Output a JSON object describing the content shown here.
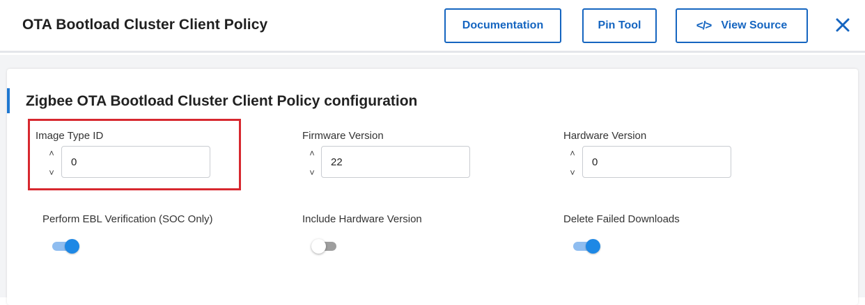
{
  "header": {
    "title": "OTA Bootload Cluster Client Policy",
    "buttons": {
      "documentation": "Documentation",
      "pin_tool": "Pin Tool",
      "view_source": "View Source",
      "view_source_icon": "</>"
    },
    "close_glyph": "×"
  },
  "section": {
    "title": "Zigbee OTA Bootload Cluster Client Policy configuration"
  },
  "fields": [
    {
      "label": "Image Type ID",
      "value": "0"
    },
    {
      "label": "Firmware Version",
      "value": "22"
    },
    {
      "label": "Hardware Version",
      "value": "0"
    }
  ],
  "stepper": {
    "up": "˄",
    "down": "˅"
  },
  "toggles": [
    {
      "label": "Perform EBL Verification (SOC Only)",
      "on": true
    },
    {
      "label": "Include Hardware Version",
      "on": false
    },
    {
      "label": "Delete Failed Downloads",
      "on": true
    }
  ],
  "colors": {
    "accent": "#1565c0",
    "toggle_on": "#1e88e5",
    "highlight": "#d7282f"
  },
  "icons": {
    "code": "code-icon",
    "close": "close-icon",
    "step_up": "chevron-up-icon",
    "step_down": "chevron-down-icon"
  }
}
